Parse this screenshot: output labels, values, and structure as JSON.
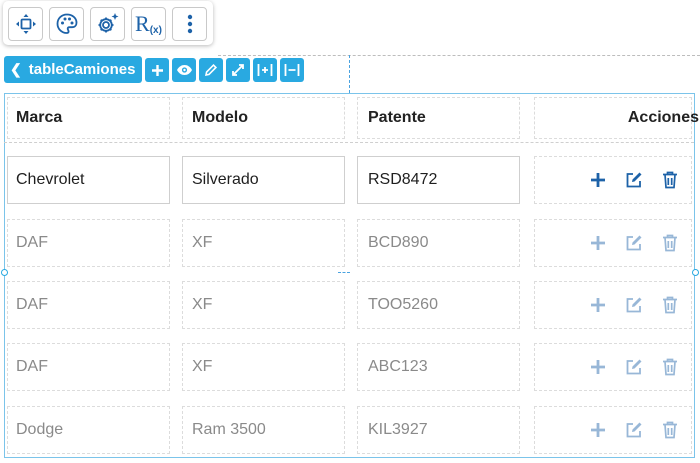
{
  "toolbar": {
    "buttons": [
      "move-icon",
      "palette-icon",
      "settings-icon",
      "rx-icon",
      "more-vert-icon"
    ],
    "rx_label": "R",
    "rx_sub": "(x)"
  },
  "component": {
    "name": "tableCamiones",
    "buttons": [
      "add-icon",
      "eye-icon",
      "pencil-icon",
      "expand-icon",
      "insert-column-icon",
      "distribute-icon"
    ]
  },
  "table": {
    "headers": {
      "marca": "Marca",
      "modelo": "Modelo",
      "patente": "Patente",
      "acciones": "Acciones"
    },
    "rows": [
      {
        "marca": "Chevrolet",
        "modelo": "Silverado",
        "patente": "RSD8472"
      },
      {
        "marca": "DAF",
        "modelo": "XF",
        "patente": "BCD890"
      },
      {
        "marca": "DAF",
        "modelo": "XF",
        "patente": "TOO5260"
      },
      {
        "marca": "DAF",
        "modelo": "XF",
        "patente": "ABC123"
      },
      {
        "marca": "Dodge",
        "modelo": "Ram 3500",
        "patente": "KIL3927"
      }
    ]
  },
  "colors": {
    "accent": "#29a9e1",
    "icon_blue": "#1d62a8",
    "border": "#7bc4ea"
  }
}
